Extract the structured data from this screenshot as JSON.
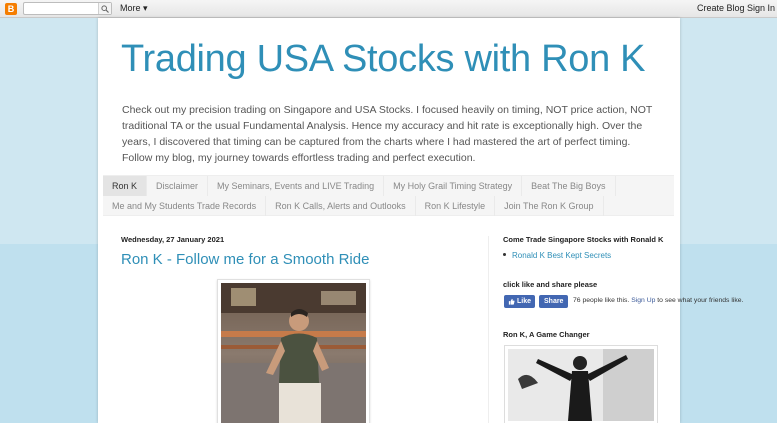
{
  "navbar": {
    "logo_letter": "B",
    "search_placeholder": "",
    "more_label": "More ▾",
    "create_blog_label": "Create Blog",
    "sign_in_label": "Sign In"
  },
  "header": {
    "title": "Trading USA Stocks with Ron K",
    "description": "Check out my precision trading on Singapore and USA Stocks. I focused heavily on timing, NOT price action, NOT traditional TA or the usual Fundamental Analysis. Hence my accuracy and hit rate is exceptionally high. Over the years, I discovered that timing can be captured from the charts where I had mastered the art of perfect timing. Follow my blog, my journey towards effortless trading and perfect execution."
  },
  "tabs": {
    "row1": [
      "Ron K",
      "Disclaimer",
      "My Seminars, Events and LIVE Trading",
      "My Holy Grail Timing Strategy",
      "Beat The Big Boys"
    ],
    "row2": [
      "Me and My Students Trade Records",
      "Ron K Calls, Alerts and Outlooks",
      "Ron K Lifestyle",
      "Join The Ron K Group"
    ]
  },
  "post": {
    "date": "Wednesday, 27 January 2021",
    "title": "Ron K - Follow me for a Smooth Ride"
  },
  "sidebar": {
    "widget1_title": "Come Trade Singapore Stocks with Ronald K",
    "widget1_link": "Ronald K Best Kept Secrets",
    "widget2_title": "click like and share please",
    "like_label": "Like",
    "share_label": "Share",
    "fb_count_text": "76 people like this.",
    "fb_signup": "Sign Up",
    "fb_after": "to see what your friends like.",
    "widget3_title": "Ron K, A Game Changer"
  },
  "colors": {
    "accent": "#2f8fb7",
    "facebook": "#4267b2",
    "background": "#b8dbe9"
  }
}
